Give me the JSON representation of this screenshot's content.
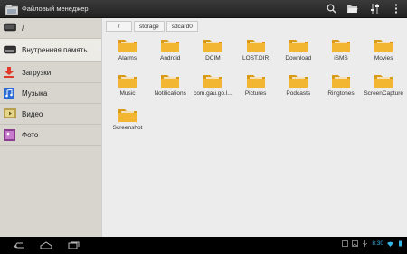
{
  "app": {
    "title": "Файловый менеджер"
  },
  "toolbar": {
    "icons": [
      "search-icon",
      "open-folder-icon",
      "settings-sliders-icon",
      "overflow-menu-icon"
    ]
  },
  "sidebar": {
    "items": [
      {
        "label": "/",
        "icon": "storage-drive-icon"
      },
      {
        "label": "Внутренняя память",
        "icon": "internal-memory-icon"
      },
      {
        "label": "Загрузки",
        "icon": "download-icon"
      },
      {
        "label": "Музыка",
        "icon": "music-icon"
      },
      {
        "label": "Видео",
        "icon": "video-icon"
      },
      {
        "label": "Фото",
        "icon": "photo-icon"
      }
    ]
  },
  "breadcrumb": [
    "/",
    "storage",
    "sdcard0"
  ],
  "folders": [
    "Alarms",
    "Android",
    "DCIM",
    "LOST.DIR",
    "Download",
    "iSMS",
    "Movies",
    "Music",
    "Notifications",
    "com.gau.go.l...",
    "Pictures",
    "Podcasts",
    "Ringtones",
    "ScreenCapture",
    "Screenshot"
  ],
  "systembar": {
    "time": "8:30"
  },
  "colors": {
    "folder": "#f2b632",
    "folder_dark": "#d99a18",
    "clock": "#33b5e5"
  }
}
